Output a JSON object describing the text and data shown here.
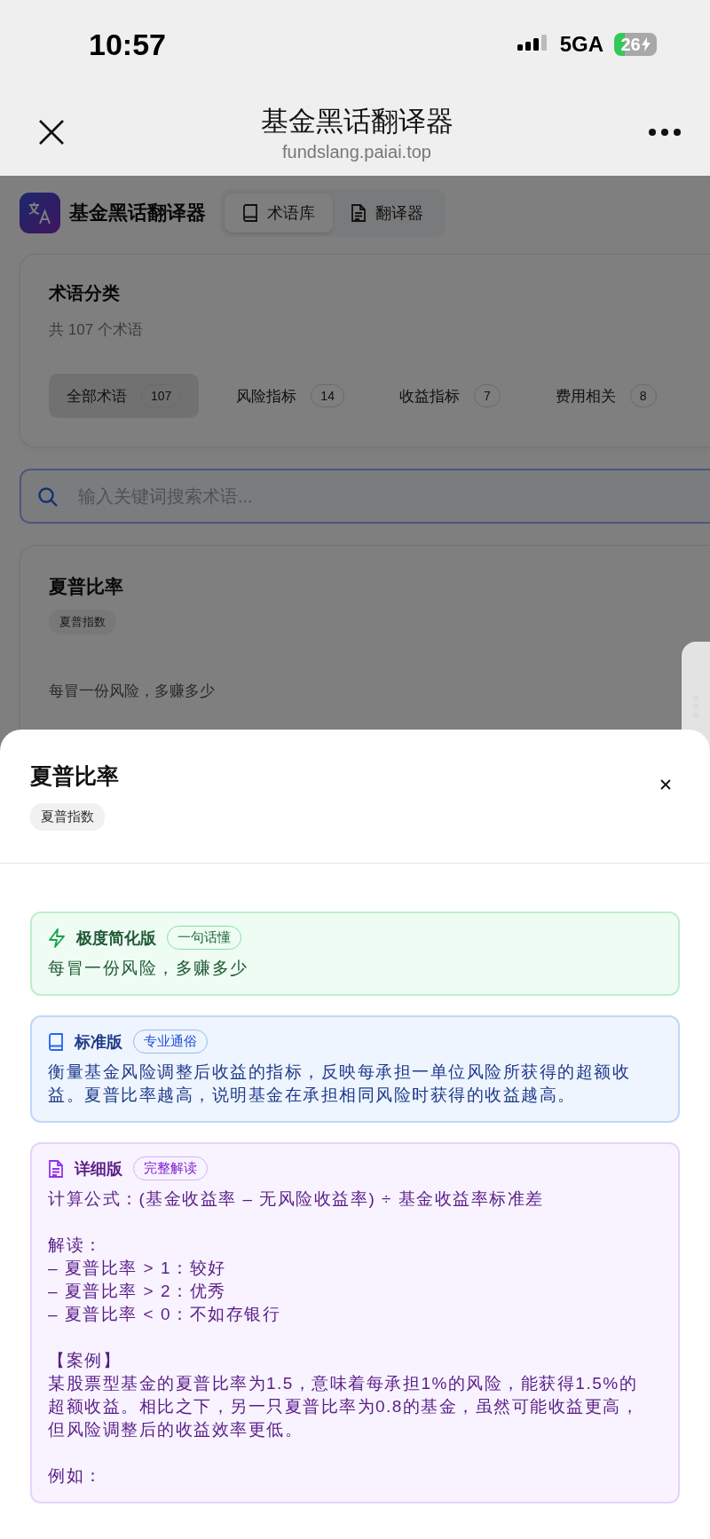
{
  "status_bar": {
    "time": "10:57",
    "network": "5GA",
    "battery": "26"
  },
  "nav": {
    "title": "基金黑话翻译器",
    "url": "fundslang.paiai.top"
  },
  "app_header": {
    "title": "基金黑话翻译器",
    "tabs": [
      {
        "label": "术语库",
        "selected": true
      },
      {
        "label": "翻译器",
        "selected": false
      }
    ]
  },
  "categories": {
    "title": "术语分类",
    "subtitle": "共 107 个术语",
    "items": [
      {
        "label": "全部术语",
        "count": "107",
        "selected": true
      },
      {
        "label": "风险指标",
        "count": "14",
        "selected": false
      },
      {
        "label": "收益指标",
        "count": "7",
        "selected": false
      },
      {
        "label": "费用相关",
        "count": "8",
        "selected": false
      }
    ]
  },
  "search": {
    "placeholder": "输入关键词搜索术语..."
  },
  "term_card": {
    "title": "夏普比率",
    "tag": "夏普指数",
    "summary": "每冒一份风险，多赚多少"
  },
  "sheet": {
    "title": "夏普比率",
    "tag": "夏普指数",
    "sections": [
      {
        "kind": "simple",
        "title": "极度简化版",
        "badge": "一句话懂",
        "paragraphs": [
          [
            "每冒一份风险，多赚多少"
          ]
        ]
      },
      {
        "kind": "standard",
        "title": "标准版",
        "badge": "专业通俗",
        "paragraphs": [
          [
            "衡量基金风险调整后收益的指标，反映每承担一单位风险所获得的超额收益。夏普比率越高，说明基金在承担相同风险时获得的收益越高。"
          ]
        ]
      },
      {
        "kind": "detailed",
        "title": "详细版",
        "badge": "完整解读",
        "paragraphs": [
          [
            "计算公式：(基金收益率 – 无风险收益率) ÷ 基金收益率标准差"
          ],
          [
            "解读：",
            "– 夏普比率 > 1：较好",
            "– 夏普比率 > 2：优秀",
            "– 夏普比率 < 0：不如存银行"
          ],
          [
            "【案例】",
            "某股票型基金的夏普比率为1.5，意味着每承担1%的风险，能获得1.5%的超额收益。相比之下，另一只夏普比率为0.8的基金，虽然可能收益更高，但风险调整后的收益效率更低。"
          ],
          [
            "例如："
          ]
        ]
      }
    ]
  }
}
